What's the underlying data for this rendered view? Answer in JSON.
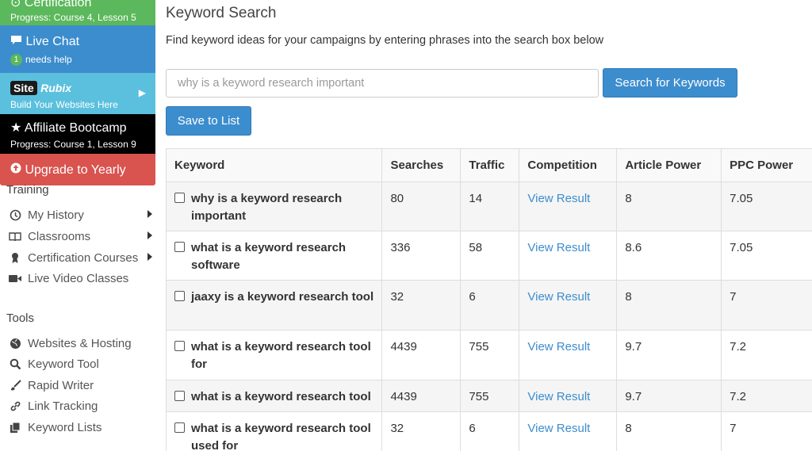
{
  "sidebar": {
    "certification": {
      "title": "Certification",
      "progress": "Progress: Course 4, Lesson 5"
    },
    "live_chat": {
      "title": "Live Chat",
      "badge": "1",
      "subtitle": "needs help"
    },
    "siterubix": {
      "logo_site": "Site",
      "logo_rubix": "Rubix",
      "subtitle": "Build Your Websites Here"
    },
    "affiliate_bootcamp": {
      "title": "Affiliate Bootcamp",
      "progress": "Progress: Course 1, Lesson 9"
    },
    "upgrade": {
      "title": "Upgrade to Yearly"
    },
    "training_label": "Training",
    "training_items": [
      {
        "label": "My History",
        "icon": "history-icon"
      },
      {
        "label": "Classrooms",
        "icon": "book-icon"
      },
      {
        "label": "Certification Courses",
        "icon": "certificate-icon"
      },
      {
        "label": "Live Video Classes",
        "icon": "video-camera-icon"
      }
    ],
    "tools_label": "Tools",
    "tools_items": [
      {
        "label": "Websites & Hosting",
        "icon": "globe-icon"
      },
      {
        "label": "Keyword Tool",
        "icon": "search-icon"
      },
      {
        "label": "Rapid Writer",
        "icon": "brush-icon"
      },
      {
        "label": "Link Tracking",
        "icon": "link-icon"
      },
      {
        "label": "Keyword Lists",
        "icon": "copy-icon"
      }
    ]
  },
  "main": {
    "title": "Keyword Search",
    "subtitle": "Find keyword ideas for your campaigns by entering phrases into the search box below",
    "search": {
      "placeholder": "why is a keyword research important",
      "button": "Search for Keywords"
    },
    "save_button": "Save to List",
    "table": {
      "headers": [
        "Keyword",
        "Searches",
        "Traffic",
        "Competition",
        "Article Power",
        "PPC Power"
      ],
      "rows": [
        {
          "keyword": "why is a keyword research important",
          "searches": "80",
          "traffic": "14",
          "competition": "View Result",
          "article_power": "8",
          "ppc_power": "7.05"
        },
        {
          "keyword": "what is a keyword research software",
          "searches": "336",
          "traffic": "58",
          "competition": "View Result",
          "article_power": "8.6",
          "ppc_power": "7.05"
        },
        {
          "keyword": "jaaxy is a keyword research tool",
          "searches": "32",
          "traffic": "6",
          "competition": "View Result",
          "article_power": "8",
          "ppc_power": "7"
        },
        {
          "keyword": "what is a keyword research tool for",
          "searches": "4439",
          "traffic": "755",
          "competition": "View Result",
          "article_power": "9.7",
          "ppc_power": "7.2"
        },
        {
          "keyword": "what is a keyword research tool",
          "searches": "4439",
          "traffic": "755",
          "competition": "View Result",
          "article_power": "9.7",
          "ppc_power": "7.2"
        },
        {
          "keyword": "what is a keyword research tool used for",
          "searches": "32",
          "traffic": "6",
          "competition": "View Result",
          "article_power": "8",
          "ppc_power": "7"
        }
      ]
    }
  }
}
